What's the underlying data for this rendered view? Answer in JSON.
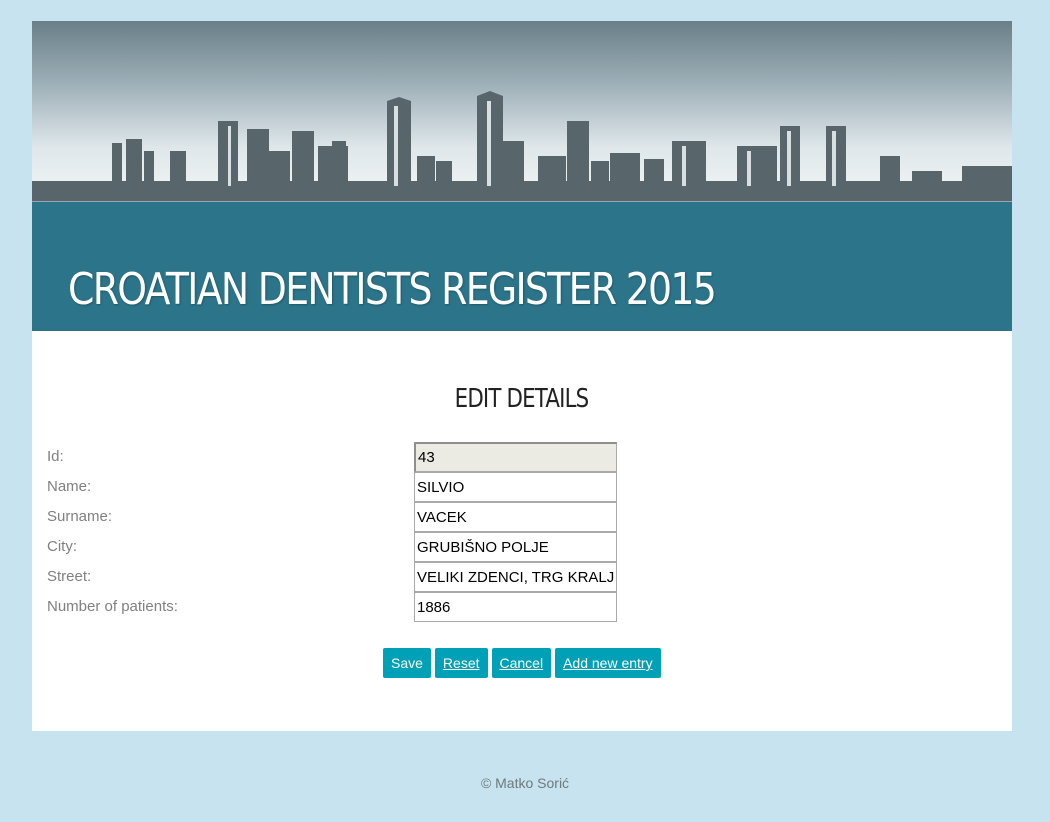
{
  "header": {
    "title": "CROATIAN DENTISTS REGISTER 2015"
  },
  "main": {
    "heading": "EDIT DETAILS",
    "fields": [
      {
        "label": "Id:",
        "value": "43"
      },
      {
        "label": "Name:",
        "value": "SILVIO"
      },
      {
        "label": "Surname:",
        "value": "VACEK"
      },
      {
        "label": "City:",
        "value": "GRUBIŠNO POLJE"
      },
      {
        "label": "Street:",
        "value": "VELIKI ZDENCI, TRG KRALJ"
      },
      {
        "label": "Number of patients:",
        "value": "1886"
      }
    ],
    "buttons": {
      "save": "Save",
      "reset": "Reset",
      "cancel": "Cancel",
      "add_new": "Add new entry"
    }
  },
  "footer": {
    "copyright": "© Matko Sorić"
  },
  "colors": {
    "background": "#c6e3ef",
    "banner": "#2b7489",
    "button": "#00a1b6"
  }
}
